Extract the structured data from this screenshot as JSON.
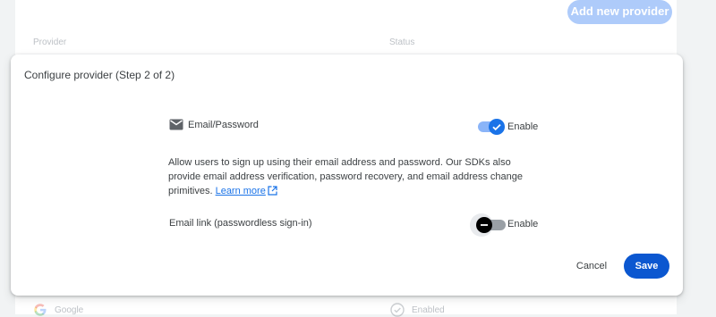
{
  "background": {
    "add_button_label": "Add new provider",
    "column_provider": "Provider",
    "column_status": "Status",
    "row": {
      "provider": "Google",
      "status": "Enabled"
    }
  },
  "dialog": {
    "title": "Configure provider (Step 2 of 2)",
    "email_password": {
      "label": "Email/Password",
      "icon": "mail-icon",
      "toggle_label": "Enable",
      "enabled": true
    },
    "description": "Allow users to sign up using their email address and password. Our SDKs also provide email address verification, password recovery, and email address change primitives.",
    "learn_more": "Learn more",
    "email_link": {
      "label": "Email link (passwordless sign-in)",
      "toggle_label": "Enable",
      "enabled": false
    },
    "cancel_label": "Cancel",
    "save_label": "Save"
  },
  "colors": {
    "primary": "#0b57d0",
    "toggle_on": "#1a73e8",
    "toggle_on_track": "#8ab4f8",
    "link": "#1a73e8",
    "add_button_disabled": "#aecbfa"
  }
}
